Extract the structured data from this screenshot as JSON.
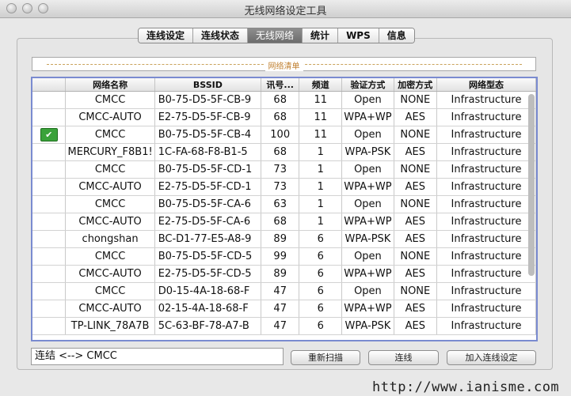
{
  "window": {
    "title": "无线网络设定工具"
  },
  "tabs": [
    {
      "label": "连线设定"
    },
    {
      "label": "连线状态"
    },
    {
      "label": "无线网络",
      "active": true
    },
    {
      "label": "统计"
    },
    {
      "label": "WPS"
    },
    {
      "label": "信息"
    }
  ],
  "group": {
    "title": "网络清单"
  },
  "table": {
    "columns": [
      "",
      "网络名称",
      "BSSID",
      "讯号...",
      "频道",
      "验证方式",
      "加密方式",
      "网络型态"
    ],
    "rows": [
      {
        "icon": "",
        "ssid": "CMCC",
        "bssid": "B0-75-D5-5F-CB-9",
        "signal": "68",
        "channel": "11",
        "auth": "Open",
        "enc": "NONE",
        "type": "Infrastructure"
      },
      {
        "icon": "",
        "ssid": "CMCC-AUTO",
        "bssid": "E2-75-D5-5F-CB-9",
        "signal": "68",
        "channel": "11",
        "auth": "WPA+WP",
        "enc": "AES",
        "type": "Infrastructure"
      },
      {
        "icon": "connected-icon",
        "ssid": "CMCC",
        "bssid": "B0-75-D5-5F-CB-4",
        "signal": "100",
        "channel": "11",
        "auth": "Open",
        "enc": "NONE",
        "type": "Infrastructure"
      },
      {
        "icon": "",
        "ssid": "MERCURY_F8B1!",
        "bssid": "1C-FA-68-F8-B1-5",
        "signal": "68",
        "channel": "1",
        "auth": "WPA-PSK",
        "enc": "AES",
        "type": "Infrastructure"
      },
      {
        "icon": "",
        "ssid": "CMCC",
        "bssid": "B0-75-D5-5F-CD-1",
        "signal": "73",
        "channel": "1",
        "auth": "Open",
        "enc": "NONE",
        "type": "Infrastructure"
      },
      {
        "icon": "",
        "ssid": "CMCC-AUTO",
        "bssid": "E2-75-D5-5F-CD-1",
        "signal": "73",
        "channel": "1",
        "auth": "WPA+WP",
        "enc": "AES",
        "type": "Infrastructure"
      },
      {
        "icon": "",
        "ssid": "CMCC",
        "bssid": "B0-75-D5-5F-CA-6",
        "signal": "63",
        "channel": "1",
        "auth": "Open",
        "enc": "NONE",
        "type": "Infrastructure"
      },
      {
        "icon": "",
        "ssid": "CMCC-AUTO",
        "bssid": "E2-75-D5-5F-CA-6",
        "signal": "68",
        "channel": "1",
        "auth": "WPA+WP",
        "enc": "AES",
        "type": "Infrastructure"
      },
      {
        "icon": "",
        "ssid": "chongshan",
        "bssid": "BC-D1-77-E5-A8-9",
        "signal": "89",
        "channel": "6",
        "auth": "WPA-PSK",
        "enc": "AES",
        "type": "Infrastructure"
      },
      {
        "icon": "",
        "ssid": "CMCC",
        "bssid": "B0-75-D5-5F-CD-5",
        "signal": "99",
        "channel": "6",
        "auth": "Open",
        "enc": "NONE",
        "type": "Infrastructure"
      },
      {
        "icon": "",
        "ssid": "CMCC-AUTO",
        "bssid": "E2-75-D5-5F-CD-5",
        "signal": "89",
        "channel": "6",
        "auth": "WPA+WP",
        "enc": "AES",
        "type": "Infrastructure"
      },
      {
        "icon": "",
        "ssid": "CMCC",
        "bssid": "D0-15-4A-18-68-F",
        "signal": "47",
        "channel": "6",
        "auth": "Open",
        "enc": "NONE",
        "type": "Infrastructure"
      },
      {
        "icon": "",
        "ssid": "CMCC-AUTO",
        "bssid": "02-15-4A-18-68-F",
        "signal": "47",
        "channel": "6",
        "auth": "WPA+WP",
        "enc": "AES",
        "type": "Infrastructure"
      },
      {
        "icon": "",
        "ssid": "TP-LINK_78A7B",
        "bssid": "5C-63-BF-78-A7-B",
        "signal": "47",
        "channel": "6",
        "auth": "WPA-PSK",
        "enc": "AES",
        "type": "Infrastructure"
      }
    ]
  },
  "status": {
    "text": "连结 <--> CMCC"
  },
  "buttons": {
    "rescan": "重新扫描",
    "connect": "连线",
    "add_profile": "加入连线设定"
  },
  "watermark": "http://www.ianisme.com"
}
